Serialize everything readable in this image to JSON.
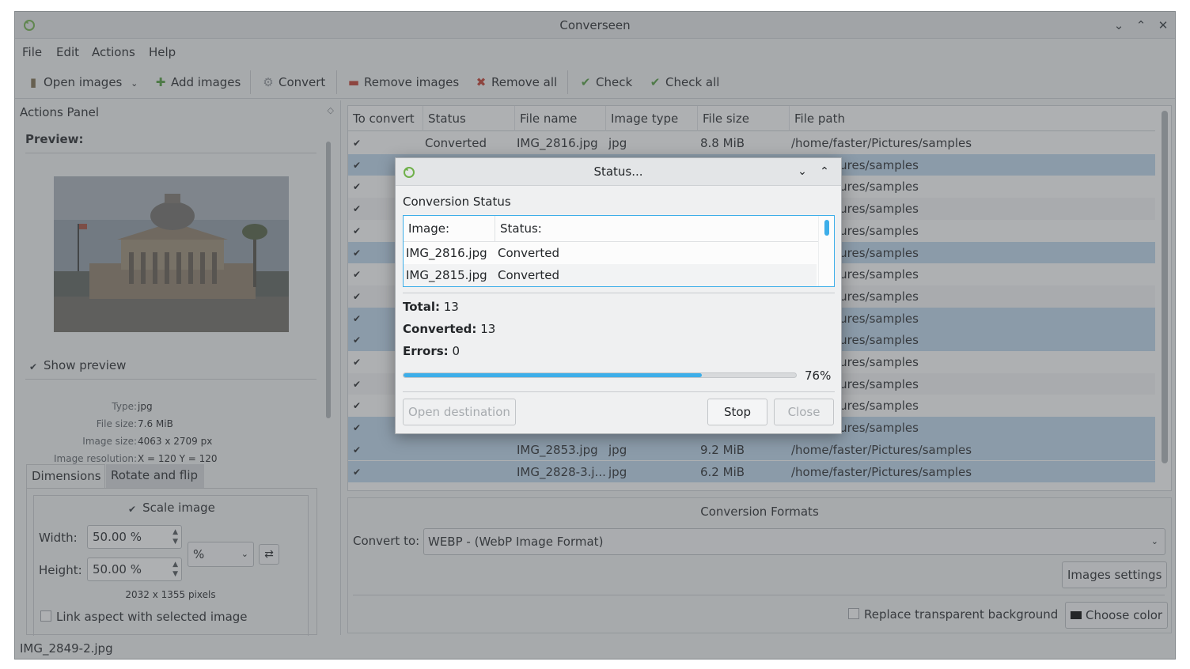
{
  "window": {
    "title": "Converseen"
  },
  "menu": [
    "File",
    "Edit",
    "Actions",
    "Help"
  ],
  "toolbar": {
    "open_images": "Open images",
    "add_images": "Add images",
    "convert": "Convert",
    "remove_images": "Remove images",
    "remove_all": "Remove all",
    "check": "Check",
    "check_all": "Check all"
  },
  "actions_panel": {
    "title": "Actions Panel",
    "preview_label": "Preview:",
    "show_preview": "Show preview",
    "info": [
      {
        "key": "Type:",
        "value": "jpg"
      },
      {
        "key": "File size:",
        "value": "7.6 MiB"
      },
      {
        "key": "Image size:",
        "value": "4063 x 2709 px"
      },
      {
        "key": "Image resolution:",
        "value": "X = 120 Y = 120"
      }
    ],
    "tabs": [
      "Dimensions",
      "Rotate and flip"
    ],
    "scale_image": "Scale image",
    "width_label": "Width:",
    "width_value": "50.00 %",
    "height_label": "Height:",
    "height_value": "50.00 %",
    "unit": "%",
    "pixels": "2032 x 1355 pixels",
    "link_aspect": "Link aspect with selected image"
  },
  "table": {
    "headers": [
      "To convert",
      "Status",
      "File name",
      "Image type",
      "File size",
      "File path"
    ],
    "rows": [
      {
        "status": "Converted",
        "name": "IMG_2816.jpg",
        "type": "jpg",
        "size": "8.8 MiB",
        "path": "/home/faster/Pictures/samples",
        "selected": false
      },
      {
        "status": "",
        "name": "",
        "type": "",
        "size": "",
        "path": "ster/Pictures/samples",
        "selected": true
      },
      {
        "status": "",
        "name": "",
        "type": "",
        "size": "",
        "path": "ster/Pictures/samples",
        "selected": false
      },
      {
        "status": "",
        "name": "",
        "type": "",
        "size": "",
        "path": "ster/Pictures/samples",
        "selected": false
      },
      {
        "status": "",
        "name": "",
        "type": "",
        "size": "",
        "path": "ster/Pictures/samples",
        "selected": false
      },
      {
        "status": "",
        "name": "",
        "type": "",
        "size": "",
        "path": "ster/Pictures/samples",
        "selected": true
      },
      {
        "status": "",
        "name": "",
        "type": "",
        "size": "",
        "path": "ster/Pictures/samples",
        "selected": false
      },
      {
        "status": "",
        "name": "",
        "type": "",
        "size": "",
        "path": "ster/Pictures/samples",
        "selected": false
      },
      {
        "status": "",
        "name": "",
        "type": "",
        "size": "",
        "path": "ster/Pictures/samples",
        "selected": true
      },
      {
        "status": "",
        "name": "",
        "type": "",
        "size": "",
        "path": "ster/Pictures/samples",
        "selected": true
      },
      {
        "status": "",
        "name": "",
        "type": "",
        "size": "",
        "path": "ster/Pictures/samples",
        "selected": false
      },
      {
        "status": "",
        "name": "",
        "type": "",
        "size": "",
        "path": "ster/Pictures/samples",
        "selected": false
      },
      {
        "status": "",
        "name": "",
        "type": "",
        "size": "",
        "path": "ster/Pictures/samples",
        "selected": false
      },
      {
        "status": "",
        "name": "",
        "type": "",
        "size": "",
        "path": "ster/Pictures/samples",
        "selected": true
      },
      {
        "status": "",
        "name": "IMG_2853.jpg",
        "type": "jpg",
        "size": "9.2 MiB",
        "path": "/home/faster/Pictures/samples",
        "selected": true
      },
      {
        "status": "",
        "name": "IMG_2828-3.j...",
        "type": "jpg",
        "size": "6.2 MiB",
        "path": "/home/faster/Pictures/samples",
        "selected": true
      }
    ]
  },
  "formats": {
    "title": "Conversion Formats",
    "convert_to_label": "Convert to:",
    "convert_to_value": "WEBP - (WebP Image Format)",
    "images_settings": "Images settings",
    "replace_bg": "Replace transparent background",
    "choose_color": "Choose color"
  },
  "statusbar": {
    "text": "IMG_2849-2.jpg"
  },
  "dialog": {
    "title": "Status...",
    "section": "Conversion Status",
    "list_headers": [
      "Image:",
      "Status:"
    ],
    "list_rows": [
      {
        "image": "IMG_2816.jpg",
        "status": "Converted"
      },
      {
        "image": "IMG_2815.jpg",
        "status": "Converted"
      }
    ],
    "total_label": "Total:",
    "total": "13",
    "converted_label": "Converted:",
    "converted": "13",
    "errors_label": "Errors:",
    "errors": "0",
    "progress_percent": 76,
    "progress_text": "76%",
    "open_destination": "Open destination",
    "stop": "Stop",
    "close": "Close"
  },
  "colors": {
    "accent": "#3daee9",
    "selection": "#bcd6ec",
    "window_bg": "#eff0f1"
  },
  "icons": [
    "app-icon",
    "open-images-icon",
    "add-images-icon",
    "convert-icon",
    "remove-images-icon",
    "remove-all-icon",
    "check-icon",
    "check-all-icon"
  ]
}
